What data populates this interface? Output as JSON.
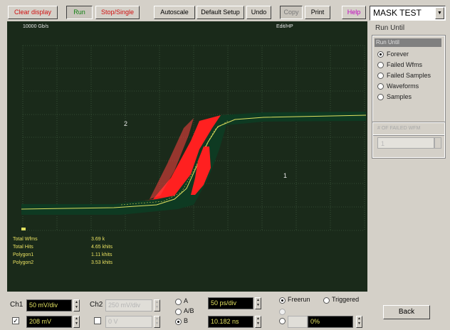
{
  "toolbar": {
    "clear_display": "Clear display",
    "run": "Run",
    "stop_single": "Stop/Single",
    "autoscale": "Autoscale",
    "default_setup": "Default Setup",
    "undo": "Undo",
    "copy": "Copy",
    "print": "Print",
    "help": "Help"
  },
  "mode_select": {
    "value": "MASK TEST"
  },
  "scope": {
    "header_left": "10000 Gb/s",
    "header_right": "Edit/HP",
    "region_label_upper": "2",
    "region_label_lower": "1"
  },
  "stats": [
    {
      "label": "Total Wfms",
      "value": "3.69 k"
    },
    {
      "label": "Total Hits",
      "value": "4.65 khits"
    },
    {
      "label": "Polygon1",
      "value": "1.11 khits"
    },
    {
      "label": "Polygon2",
      "value": "3.53 khits"
    }
  ],
  "run_until": {
    "title": "Run Until",
    "group_label": "Run Until",
    "options": [
      "Forever",
      "Failed Wfms",
      "Failed Samples",
      "Waveforms",
      "Samples"
    ],
    "selected_index": 0,
    "failed_count_label": "# OF FAILED WFM",
    "failed_count_value": "1"
  },
  "back_button": "Back",
  "bottom": {
    "ch1_label": "Ch1",
    "ch1_scale": "50 mV/div",
    "ch1_offset": "208 mV",
    "ch2_label": "Ch2",
    "ch2_scale": "250 mV/div",
    "ch2_offset": "0 V",
    "source_options": [
      "A",
      "A/B",
      "B"
    ],
    "timebase": "50 ps/div",
    "delay": "10.182 ns",
    "trigger_freerun": "Freerun",
    "trigger_triggered": "Triggered",
    "trigger_level": "0%"
  }
}
